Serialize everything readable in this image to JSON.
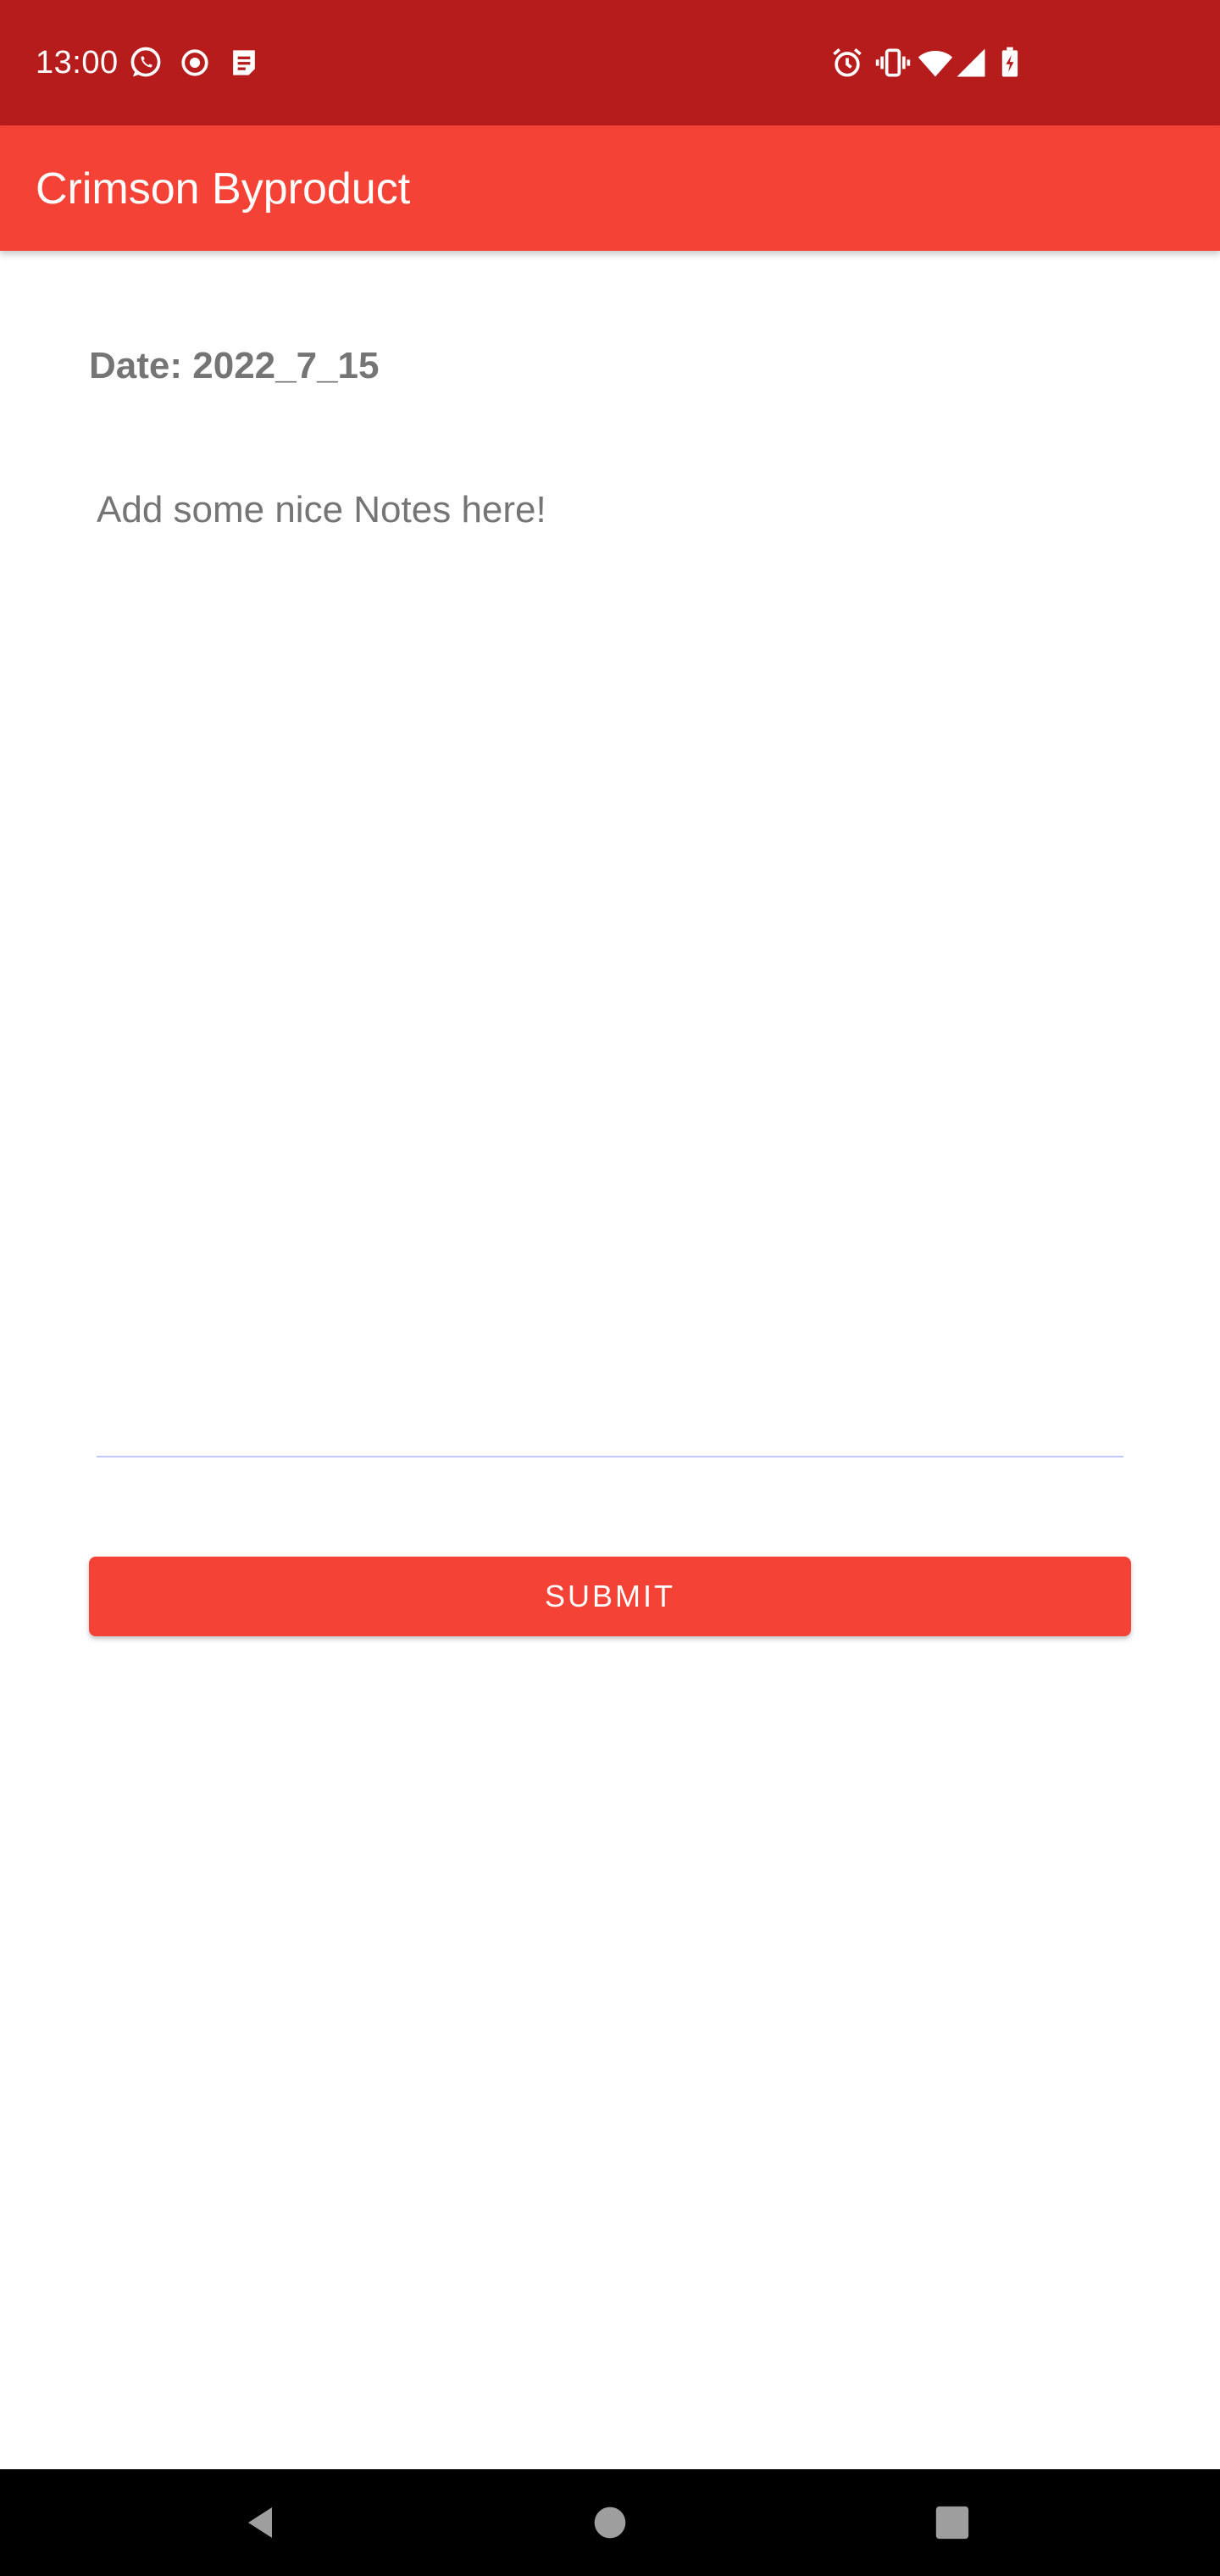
{
  "status_bar": {
    "time": "13:00",
    "background": "#B71C1C",
    "left_icons": [
      "whatsapp-icon",
      "record-icon",
      "notes-icon"
    ],
    "right_icons": [
      "alarm-icon",
      "vibrate-icon",
      "wifi-icon",
      "signal-icon",
      "battery-charging-icon"
    ]
  },
  "app_bar": {
    "title": "Crimson Byproduct",
    "background": "#F44336"
  },
  "form": {
    "date_label": "Date: 2022_7_15",
    "notes_value": "",
    "notes_placeholder": "Add some nice Notes here!",
    "submit_label": "SUBMIT",
    "accent": "#F44336",
    "underline_color": "#C5C8F7"
  },
  "nav_bar": {
    "buttons": [
      "back-icon",
      "home-icon",
      "recents-icon"
    ]
  }
}
